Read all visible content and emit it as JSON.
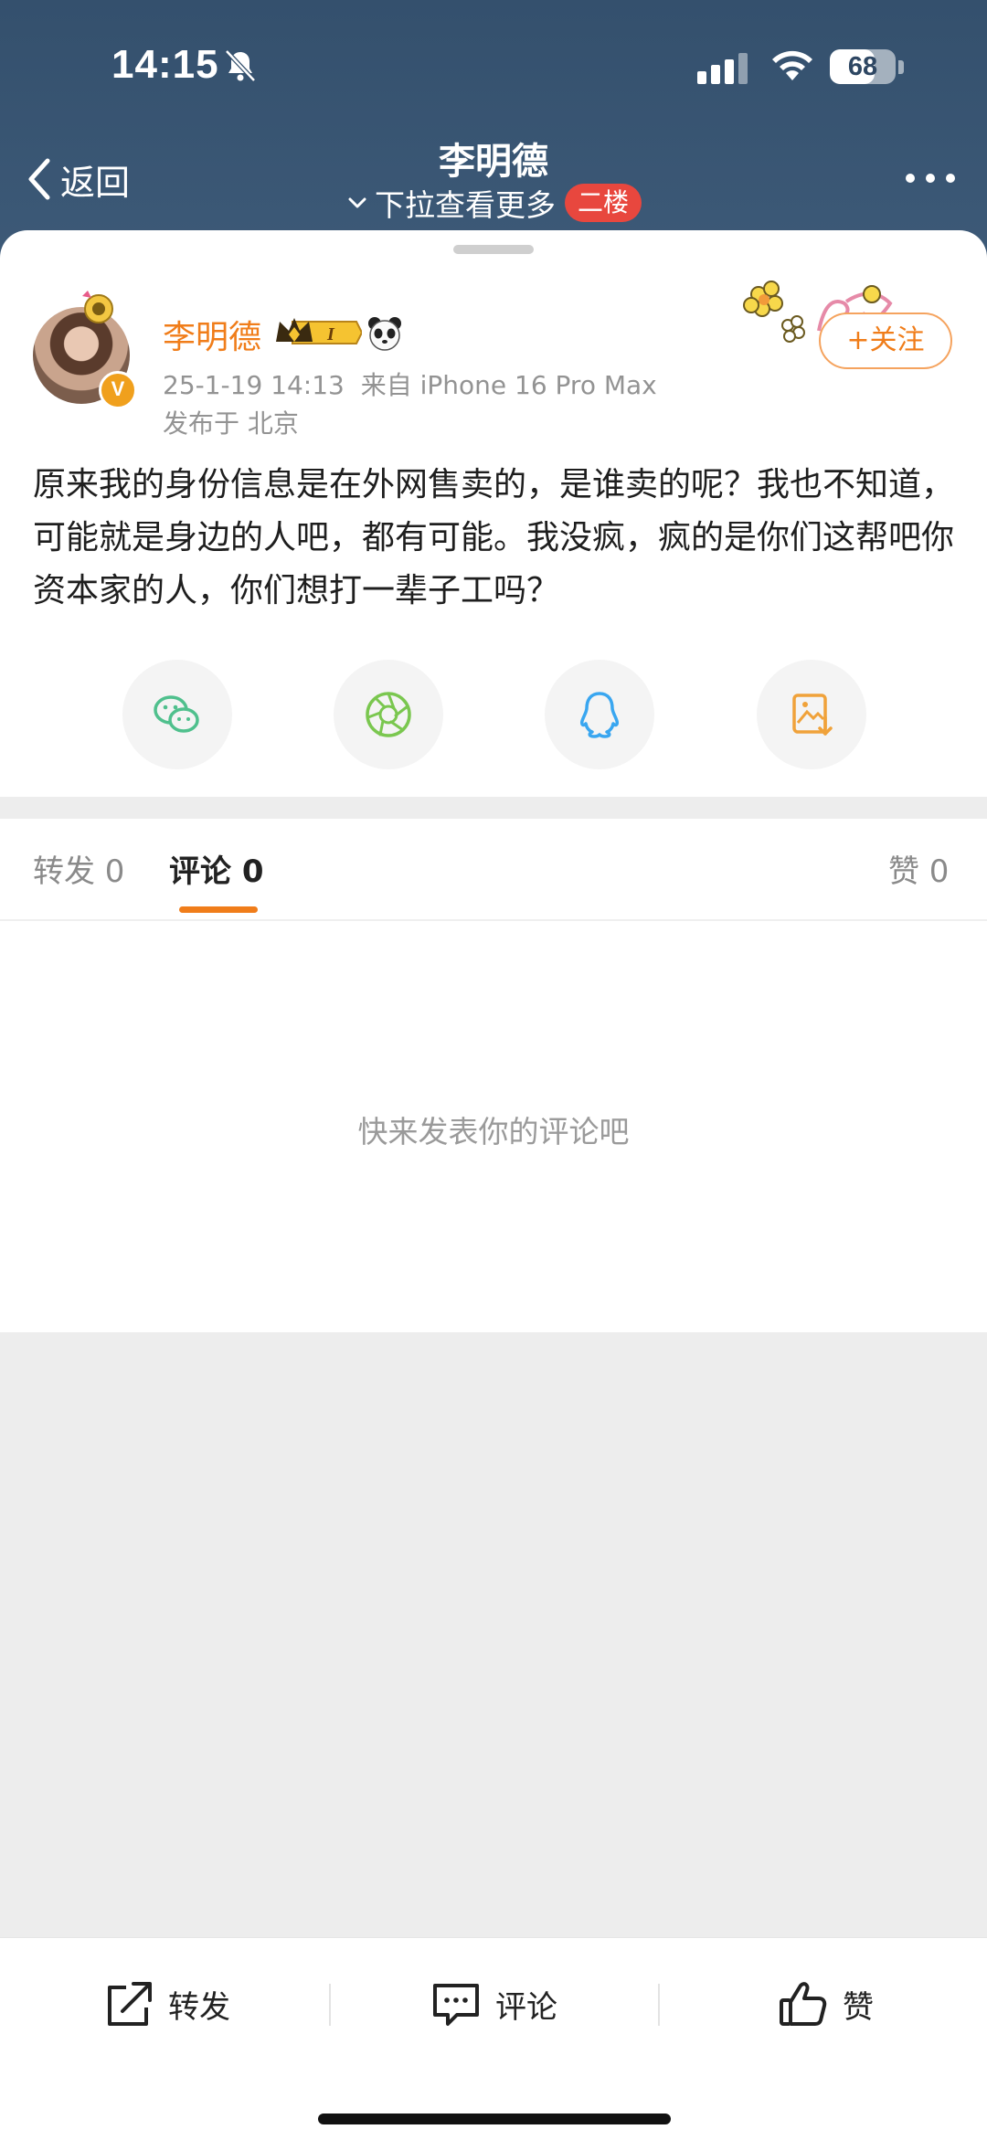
{
  "status_bar": {
    "time": "14:15",
    "battery_level": "68",
    "battery_fraction": 0.68,
    "icons": [
      "bell-muted-icon",
      "cellular-signal-icon",
      "wifi-icon",
      "battery-icon"
    ]
  },
  "nav": {
    "back_label": "返回",
    "title": "李明德",
    "subtitle": "下拉查看更多",
    "floor_badge": "二楼",
    "badge_color": "#e8473e"
  },
  "post": {
    "author": "李明德",
    "date": "25-1-19 14:13",
    "source": "来自 iPhone 16 Pro Max",
    "location": "发布于 北京",
    "follow_label": "+关注",
    "verified_mark": "V",
    "vip_level": "I",
    "body": "原来我的身份信息是在外网售卖的，是谁卖的呢？我也不知道，可能就是身边的人吧，都有可能。我没疯，疯的是你们这帮吧你资本家的人，你们想打一辈子工吗？",
    "accent_color": "#f07d1a"
  },
  "share_targets": [
    {
      "name": "wechat",
      "icon": "wechat-icon",
      "color": "#4fc08d"
    },
    {
      "name": "moments",
      "icon": "moments-icon",
      "color": "#7ac74f"
    },
    {
      "name": "qq",
      "icon": "qq-icon",
      "color": "#39a6f0"
    },
    {
      "name": "save-image",
      "icon": "save-image-icon",
      "color": "#f0a23a"
    }
  ],
  "tabs": {
    "repost": "转发 0",
    "comment": "评论 0",
    "like": "赞 0",
    "active": "comment"
  },
  "empty_hint": "快来发表你的评论吧",
  "bottom_bar": {
    "repost": "转发",
    "comment": "评论",
    "like": "赞"
  }
}
